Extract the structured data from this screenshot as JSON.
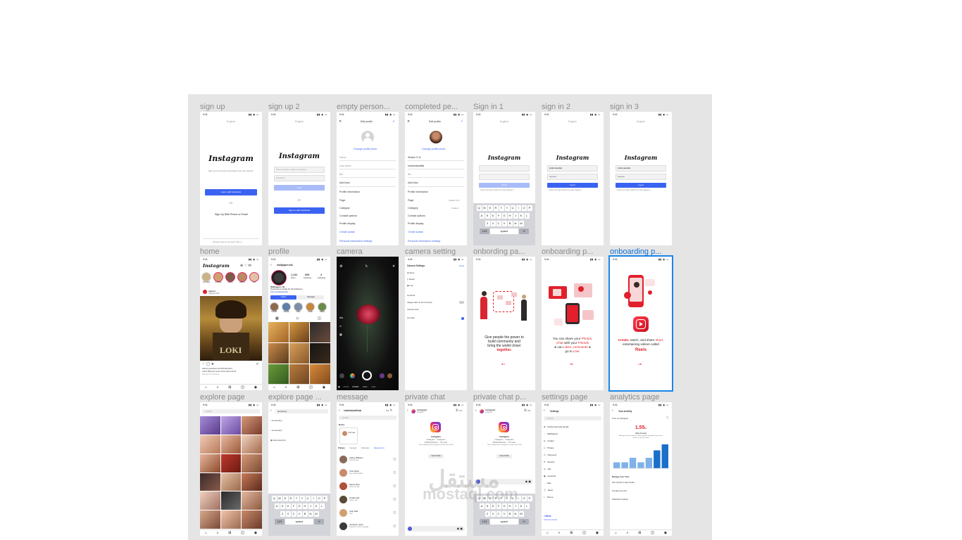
{
  "frames": [
    {
      "label": "sign up"
    },
    {
      "label": "sign up 2"
    },
    {
      "label": "empty person..."
    },
    {
      "label": "completed pe..."
    },
    {
      "label": "Sign in 1"
    },
    {
      "label": "sign in 2"
    },
    {
      "label": "sign in 3"
    },
    {
      "label": "home"
    },
    {
      "label": "profile"
    },
    {
      "label": "camera"
    },
    {
      "label": "camera setting"
    },
    {
      "label": "onbording pa..."
    },
    {
      "label": "onboarding p..."
    },
    {
      "label": "onboarding p..."
    },
    {
      "label": "explore page"
    },
    {
      "label": "explore page ..."
    },
    {
      "label": "message"
    },
    {
      "label": "private chat"
    },
    {
      "label": "private chat p..."
    },
    {
      "label": "settings page"
    },
    {
      "label": "analytics page"
    }
  ],
  "screens": {
    "time": "9:41",
    "signup": {
      "logo": "Instagram",
      "desc": "Sign up to see photos and videos from your friends.",
      "fb_button": "Log in with Facebook",
      "or": "OR",
      "alt": "Sign Up With Phone or Email",
      "footer": "Already have an account? Sign in.",
      "lang": "English"
    },
    "signup2": {
      "logo": "Instagram",
      "phone_placeholder": "Phone number, email or username",
      "password_placeholder": "Password",
      "next": "Next",
      "or": "OR",
      "fb_button": "Sign up with Facebook",
      "lang": "English"
    },
    "editprofile": {
      "title": "Edit profile",
      "change_photo": "Change profile photo",
      "name": "Name",
      "username": "Username",
      "username_value": "shahindaraflial",
      "name_value": "Shahin D N",
      "bio": "Bio",
      "add_links": "Add links",
      "profile_info": "Profile information",
      "page": "Page",
      "page_value": "Shahin D N",
      "category": "Category",
      "category_value": "Student",
      "contact": "Contact options",
      "profile_display": "Profile display",
      "create_avatar": "Create avatar",
      "personal_info": "Personal information settings"
    },
    "signin": {
      "logo": "Instagram",
      "user_value": "shahindaraflial",
      "pass_value": "••••••••••",
      "login": "Log in",
      "forgot": "Forgot your login details? Get help logging in.",
      "keys_row1": [
        "Q",
        "W",
        "E",
        "R",
        "T",
        "Y",
        "U",
        "I",
        "O",
        "P"
      ],
      "keys_row2": [
        "A",
        "S",
        "D",
        "F",
        "G",
        "H",
        "J",
        "K",
        "L"
      ],
      "keys_row3": [
        "Z",
        "X",
        "C",
        "V",
        "B",
        "N",
        "M"
      ],
      "k123": "123",
      "space": "space",
      "lang": "English"
    },
    "home": {
      "logo": "Instagram",
      "stories": [
        "Your story",
        "tevchaliz",
        "cathlee",
        "kathryn",
        "emi"
      ],
      "post_user": "marvel",
      "post_subtitle": "Original audio",
      "liked_by": "Liked by thekurtman and 960,228 others",
      "caption": "marvel What you need to know about Loki S2",
      "comments": "View all 237 comments"
    },
    "profile": {
      "username": "wallpapers4k",
      "posts_n": "1,132",
      "posts_l": "Posts",
      "followers_n": "60K",
      "followers_l": "Followers",
      "following_n": "4",
      "following_l": "Following",
      "name": "Wallpapers 4K",
      "bio": "Downloads bestwalls 4K HD wallpapers",
      "link": "linktr.ee/wallpapers4k",
      "follow": "Follow",
      "message": "Message",
      "highlights": [
        "Popular",
        "Animals",
        "Cities",
        "Foods",
        "Nature"
      ]
    },
    "camera": {
      "mode1": "POST",
      "mode2": "STORY",
      "mode3": "REEL",
      "mode4": "LIVE",
      "aa": "Aa"
    },
    "camsettings": {
      "title": "Camera Settings",
      "done": "Done",
      "items": [
        "Story",
        "Reels",
        "Live"
      ],
      "controls": "Controls",
      "always_start": "Always start on front camera",
      "toolbar": "Camera tools",
      "left_side": "Left side"
    },
    "onboard1": {
      "line1": "Give people the power to",
      "line2": "build community and",
      "line3": "bring the world closer",
      "line4": "together."
    },
    "onboard2": {
      "line1": "You can share your",
      "photos": "Photos,",
      "line2a": "Chat",
      "line2b": "with your",
      "friends": "Friends",
      "line3a": "& can",
      "likes": "Likes,",
      "comments": "comments",
      "line3b": "&",
      "line4a": "go to",
      "live": "Live."
    },
    "onboard3": {
      "create": "Create,",
      "line1": "watch, and share",
      "short": "short,",
      "line2": "entertaining videos called",
      "reels": "Reels"
    },
    "explore": {
      "search": "Search"
    },
    "explore2": {
      "query": "dementory",
      "results": [
        "dementory",
        "dementory",
        "dementory2.0"
      ],
      "k123": "123",
      "space": "space"
    },
    "message": {
      "title": "shahindaraflicial",
      "search": "Search",
      "notes": "Notes",
      "your_note": "Your note",
      "tabs": [
        "Primary",
        "General",
        "Channels",
        "Requests (2)"
      ],
      "chats": [
        {
          "name": "Jeffrey Williams",
          "msg": "Sent 2d ago"
        },
        {
          "name": "Tulsi Sinha",
          "msg": "Seen Wednesday"
        },
        {
          "name": "Naomi Deol",
          "msg": "Active 2h ago"
        },
        {
          "name": "Jordan Hell",
          "msg": "Active now"
        },
        {
          "name": "Juan Diaz",
          "msg": "Sent"
        },
        {
          "name": "merckson_dave",
          "msg": "Reacted to your message"
        }
      ]
    },
    "chat": {
      "title": "Instagram",
      "subtitle": "instagram",
      "name": "Instagram",
      "handle": "instagram · Instagram",
      "followers": "654M followers · 7K posts",
      "follow_note": "You've followed this Instagram account since 2018",
      "view_profile": "View Profile",
      "k123": "123",
      "space": "space"
    },
    "settings": {
      "title": "Settings",
      "search": "Search",
      "items": [
        "Follow and invite friends",
        "Notifications",
        "Creator",
        "Privacy",
        "Payments",
        "Security",
        "Ads",
        "Accounts",
        "Help",
        "About",
        "Theme"
      ],
      "meta": "Meta",
      "accounts_center": "Accounts Center"
    },
    "analytics": {
      "title": "Your Activity",
      "time_label": "Time on Instagram",
      "value": "1.55",
      "unit": "m",
      "daily": "Daily Average",
      "desc": "Average time you spent per day using the Instagram app on this device in the last week",
      "manage": "Manage Your Time",
      "set_reminder": "Set reminder to take breaks",
      "set_daily": "Set daily time limit",
      "notif": "Notification Settings"
    }
  },
  "chart_data": {
    "type": "bar",
    "categories": [
      "1",
      "2",
      "3",
      "4",
      "5",
      "6",
      "7"
    ],
    "values": [
      2,
      2,
      3.5,
      2,
      3.5,
      6,
      8
    ],
    "ylim": [
      0,
      8
    ],
    "xlabel": "",
    "ylabel": ""
  },
  "watermark": {
    "text": "mostaql.com",
    "ar": "مستقل"
  },
  "colors": {
    "board": "#e5e5e5",
    "accent": "#3b63f2",
    "selection": "#1b86e8",
    "red": "#e1202b"
  }
}
